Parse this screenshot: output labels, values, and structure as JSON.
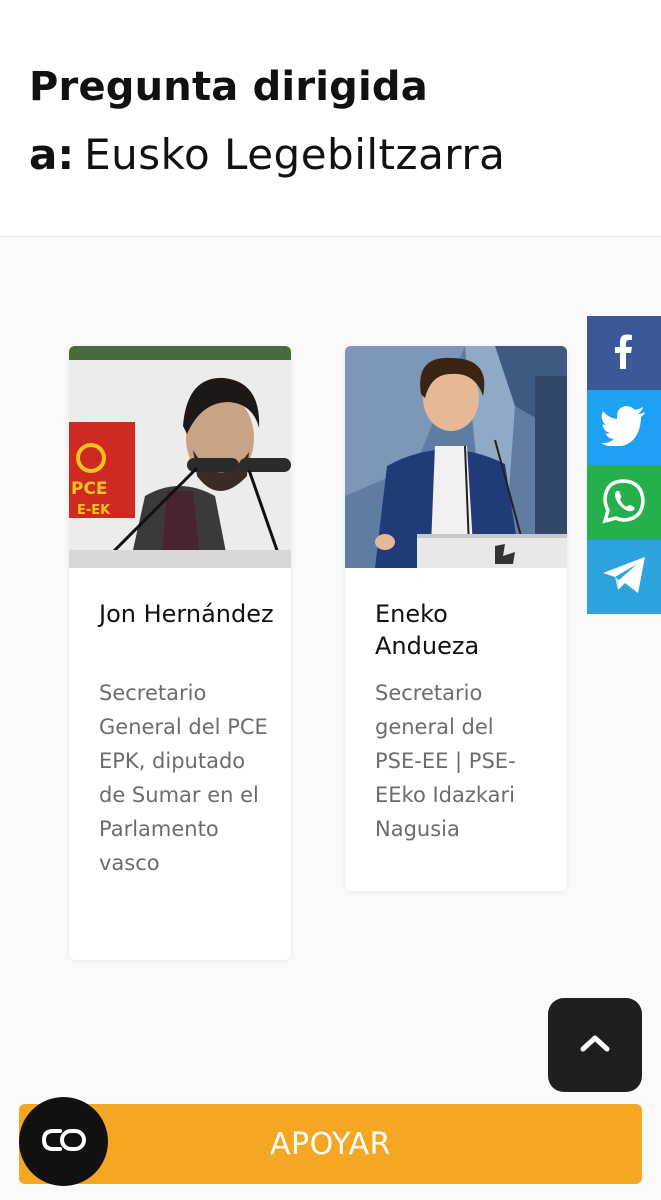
{
  "header": {
    "title": "Pregunta dirigida",
    "target_prefix": "a:",
    "target_name": "Eusko Legebiltzarra"
  },
  "recipients": [
    {
      "name": "Jon Hernández",
      "role": "Secretario General del PCE EPK, diputado de Sumar en el Parlamento vasco"
    },
    {
      "name": "Eneko Andueza",
      "role": "Secretario general del PSE-EE | PSE-EEko Idazkari Nagusia"
    }
  ],
  "share": {
    "icons": [
      "facebook-icon",
      "twitter-icon",
      "whatsapp-icon",
      "telegram-icon"
    ],
    "colors": {
      "facebook": "#3b5998",
      "twitter": "#1da1f2",
      "whatsapp": "#25b04c",
      "telegram": "#2ea2dc"
    }
  },
  "actions": {
    "support_label": "APOYAR",
    "support_color": "#f5a623",
    "scroll_top_icon": "chevron-up-icon",
    "floating_icon": "co-logo-icon"
  }
}
